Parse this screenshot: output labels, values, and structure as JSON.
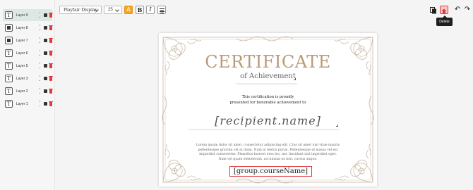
{
  "sidebar": {
    "layers": [
      {
        "name": "Layer 9",
        "type": "text",
        "active": true
      },
      {
        "name": "Layer 8",
        "type": "shape"
      },
      {
        "name": "Layer 7",
        "type": "shape"
      },
      {
        "name": "Layer 6",
        "type": "text"
      },
      {
        "name": "Layer 5",
        "type": "text"
      },
      {
        "name": "Layer 3",
        "type": "text"
      },
      {
        "name": "Layer 2",
        "type": "text"
      },
      {
        "name": "Layer 1",
        "type": "text"
      }
    ]
  },
  "toolbar": {
    "font": "Playfair Display",
    "size": "25",
    "color_icon": "A",
    "bold": "B",
    "italic": "I",
    "tooltip": "Delete",
    "accent": "#f5a623",
    "danger": "#e03a3a"
  },
  "certificate": {
    "title": "CERTIFICATE",
    "subtitle": "of Achievement",
    "body_line1": "This certification is proudly",
    "body_line2": "presented for honorable achievement to",
    "recipient": "[recipient.name]",
    "lorem": "Lorem ipsum dolor sit amet, consectetur adipiscing elit. Cras sit amet nisi vitae mauris pellentesque gravida vel at diam. Nam at metus purus. Pellentesque id massa vel est imperdiet consectetur. Phasellus laoreet eros leo, nec tincidunt nisl imperdiet eget. Nam vel quam elementum, accumsan ex non, cursus augue.",
    "course": "[group.courseName]",
    "frame_color": "#c9b8a4"
  }
}
